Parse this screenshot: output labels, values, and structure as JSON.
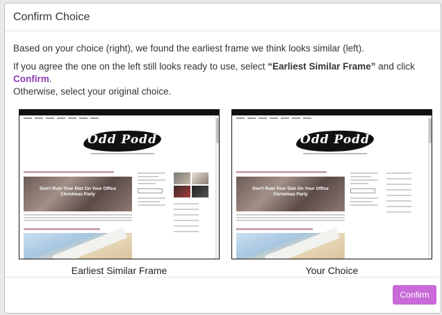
{
  "modal": {
    "title": "Confirm Choice",
    "intro": "Based on your choice (right), we found the earliest frame we think looks similar (left).",
    "instruction_pre": "If you agree the one on the left still looks ready to use, select ",
    "instruction_choice": "“Earliest Similar Frame”",
    "instruction_mid": " and click ",
    "instruction_link": "Confirm",
    "instruction_post": ".",
    "instruction_line2": "Otherwise, select your original choice."
  },
  "frames": [
    {
      "caption": "Earliest Similar Frame",
      "thumbnail": {
        "logo": "Odd Podd",
        "hero_text": "Don't Ruin Your Diet On Your Office Christmas Party"
      }
    },
    {
      "caption": "Your Choice",
      "thumbnail": {
        "logo": "Odd Podd",
        "hero_text": "Don't Ruin Your Diet On Your Office Christmas Party"
      }
    }
  ],
  "footer": {
    "confirm_label": "Confirm"
  },
  "colors": {
    "accent": "#c96ad8",
    "link": "#8a3bb5"
  }
}
